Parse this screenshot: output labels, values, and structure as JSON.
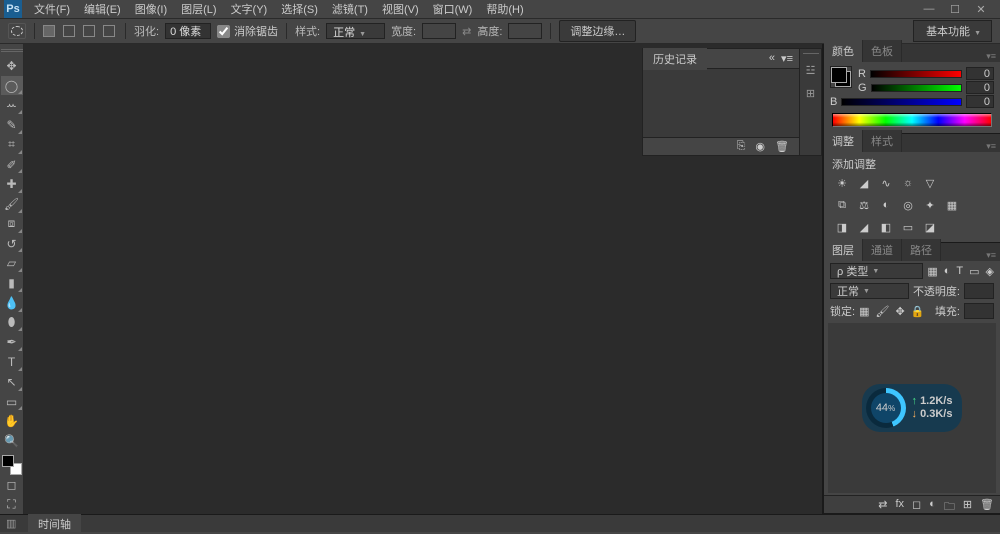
{
  "app": {
    "logo": "Ps"
  },
  "menu": {
    "items": [
      {
        "label": "文件(F)"
      },
      {
        "label": "编辑(E)"
      },
      {
        "label": "图像(I)"
      },
      {
        "label": "图层(L)"
      },
      {
        "label": "文字(Y)"
      },
      {
        "label": "选择(S)"
      },
      {
        "label": "滤镜(T)"
      },
      {
        "label": "视图(V)"
      },
      {
        "label": "窗口(W)"
      },
      {
        "label": "帮助(H)"
      }
    ]
  },
  "options": {
    "feather_label": "羽化:",
    "feather_value": "0 像素",
    "antialias_label": "消除锯齿",
    "style_label": "样式:",
    "style_value": "正常",
    "width_label": "宽度:",
    "width_value": "",
    "height_label": "高度:",
    "height_value": "",
    "refine_edge": "调整边缘…",
    "workspace": "基本功能"
  },
  "history_panel": {
    "tab": "历史记录"
  },
  "color_panel": {
    "tab_color": "颜色",
    "tab_swatches": "色板",
    "r_label": "R",
    "r_value": "0",
    "g_label": "G",
    "g_value": "0",
    "b_label": "B",
    "b_value": "0"
  },
  "adjust_panel": {
    "tab_adjust": "调整",
    "tab_style": "样式",
    "add_label": "添加调整"
  },
  "layers_panel": {
    "tab_layers": "图层",
    "tab_channels": "通道",
    "tab_paths": "路径",
    "kind_label": "ρ 类型",
    "blend_value": "正常",
    "opacity_label": "不透明度:",
    "opacity_value": "",
    "lock_label": "锁定:",
    "fill_label": "填充:",
    "fill_value": ""
  },
  "widget": {
    "percent": "44",
    "percent_suffix": "%",
    "up": "1.2K/s",
    "down": "0.3K/s"
  },
  "statusbar": {
    "timeline": "时间轴"
  }
}
